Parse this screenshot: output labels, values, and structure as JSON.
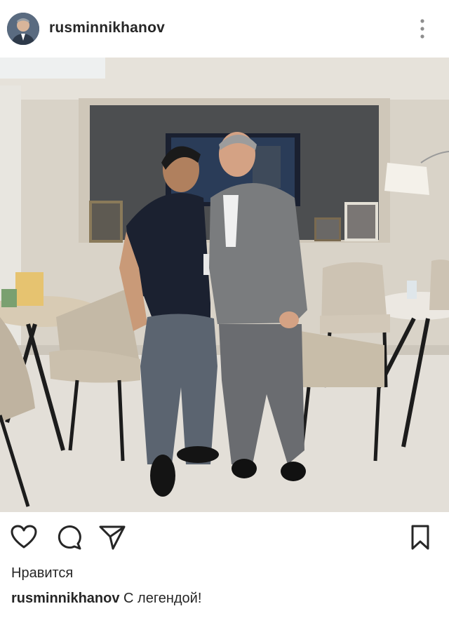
{
  "post": {
    "username": "rusminnikhanov",
    "likes_label": "Нравится",
    "caption_username": "rusminnikhanov",
    "caption_text": " С легендой!"
  },
  "icons": {
    "more": "more-vertical-icon",
    "like": "heart-icon",
    "comment": "comment-icon",
    "share": "share-icon",
    "save": "bookmark-icon"
  },
  "colors": {
    "text": "#262626",
    "background": "#ffffff",
    "icon": "#262626"
  }
}
